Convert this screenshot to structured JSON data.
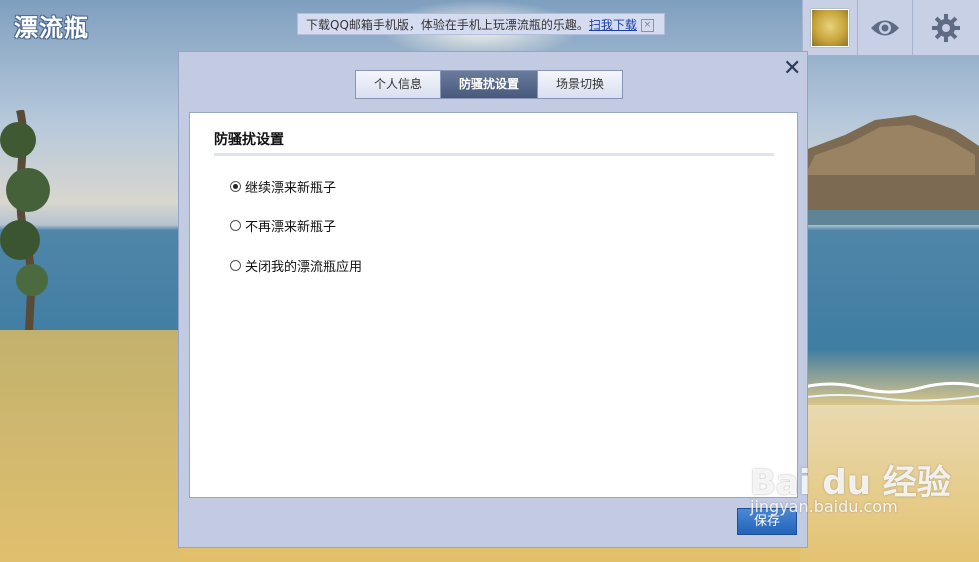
{
  "app": {
    "logo_text": "漂流瓶"
  },
  "promo": {
    "text": "下载QQ邮箱手机版，体验在手机上玩漂流瓶的乐趣。",
    "link": "扫我下载",
    "close": "×"
  },
  "topbar": {
    "avatar_icon": "avatar-portrait",
    "view_icon": "eye-icon",
    "settings_icon": "gear-icon"
  },
  "dialog": {
    "close_label": "✕",
    "tabs": [
      {
        "label": "个人信息",
        "active": false
      },
      {
        "label": "防骚扰设置",
        "active": true
      },
      {
        "label": "场景切换",
        "active": false
      }
    ],
    "section_title": "防骚扰设置",
    "options": [
      {
        "label": "继续漂来新瓶子",
        "selected": true
      },
      {
        "label": "不再漂来新瓶子",
        "selected": false
      },
      {
        "label": "关闭我的漂流瓶应用",
        "selected": false
      }
    ],
    "save_label": "保存"
  },
  "watermark": {
    "brand": "Bai du 经验",
    "url": "jingyan.baidu.com"
  },
  "colors": {
    "accent": "#2363b8",
    "tab_active": "#485a7c",
    "panel_bg": "#c3cbe3"
  }
}
